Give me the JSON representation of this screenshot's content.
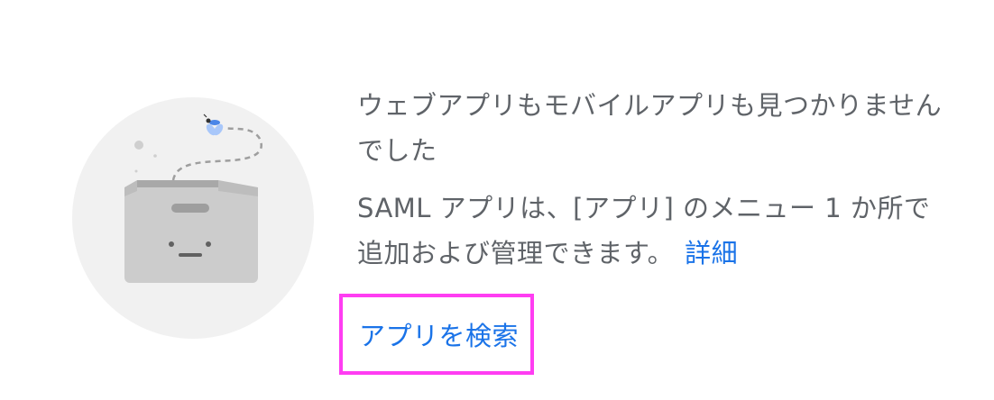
{
  "empty_state": {
    "title": "ウェブアプリもモバイルアプリも見つかりませんでした",
    "description": "SAML アプリは、[アプリ] のメニュー 1 か所で追加および管理できます。",
    "learn_more_label": "詳細",
    "search_apps_label": "アプリを検索"
  },
  "illustration": {
    "icon": "empty-box-with-fly-icon"
  },
  "colors": {
    "text_secondary": "#5f6368",
    "link": "#1a73e8",
    "highlight_border": "#ff3df2",
    "circle_background": "#f1f1f1"
  }
}
